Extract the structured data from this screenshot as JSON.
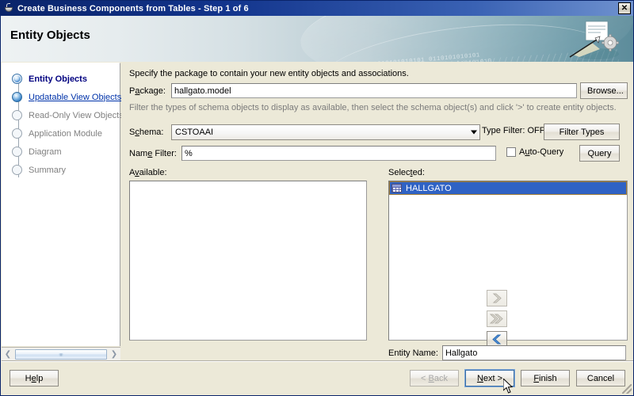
{
  "window": {
    "title": "Create Business Components from Tables - Step 1 of 6",
    "app_icon": "coffee-cup-icon",
    "close_label": "✕"
  },
  "banner": {
    "heading": "Entity Objects",
    "binary_line1": "0101010101010101 0110101010101",
    "binary_line2": "010101010101010"
  },
  "sidebar": {
    "steps": [
      {
        "label": "Entity Objects",
        "state": "current"
      },
      {
        "label": "Updatable View Objects",
        "state": "done"
      },
      {
        "label": "Read-Only View Objects",
        "state": "pending"
      },
      {
        "label": "Application Module",
        "state": "pending"
      },
      {
        "label": "Diagram",
        "state": "pending"
      },
      {
        "label": "Summary",
        "state": "pending"
      }
    ]
  },
  "main": {
    "description_package": "Specify the package to contain your new entity objects and associations.",
    "package_label": "Package:",
    "package_value": "hallgato.model",
    "browse_label": "Browse...",
    "description_filter": "Filter the types of schema objects to display as available, then select the schema object(s) and click '>' to create entity objects.",
    "schema_label": "Schema:",
    "schema_value": "CSTOAAI",
    "type_filter_text": "Type Filter: OFF",
    "filter_types_label": "Filter Types",
    "name_filter_label": "Name Filter:",
    "name_filter_value": "%",
    "auto_query_label": "Auto-Query",
    "auto_query_checked": false,
    "query_label": "Query",
    "available_label": "Available:",
    "selected_label": "Selected:",
    "available_items": [],
    "selected_items": [
      {
        "label": "HALLGATO",
        "icon": "table-icon",
        "selected": true
      }
    ],
    "transfer_buttons": [
      {
        "name": "move-right-single",
        "glyph": "❯",
        "enabled": false
      },
      {
        "name": "move-right-all",
        "glyph": "»",
        "enabled": false
      },
      {
        "name": "move-left-single",
        "glyph": "❮",
        "enabled": true
      },
      {
        "name": "move-left-all",
        "glyph": "«",
        "enabled": true
      }
    ],
    "entity_name_label": "Entity Name:",
    "entity_name_value": "Hallgato"
  },
  "footer": {
    "help_label": "Help",
    "back_label": "< Back",
    "next_label": "Next >",
    "finish_label": "Finish",
    "cancel_label": "Cancel",
    "back_enabled": false,
    "next_focused": true
  },
  "colors": {
    "titlebar_start": "#0a246a",
    "titlebar_end": "#6f92cf",
    "selection_blue": "#2f62c4",
    "selection_border": "#a07a32",
    "dialog_face": "#ece9d8",
    "step_current": "#000080",
    "step_link": "#0033aa"
  }
}
